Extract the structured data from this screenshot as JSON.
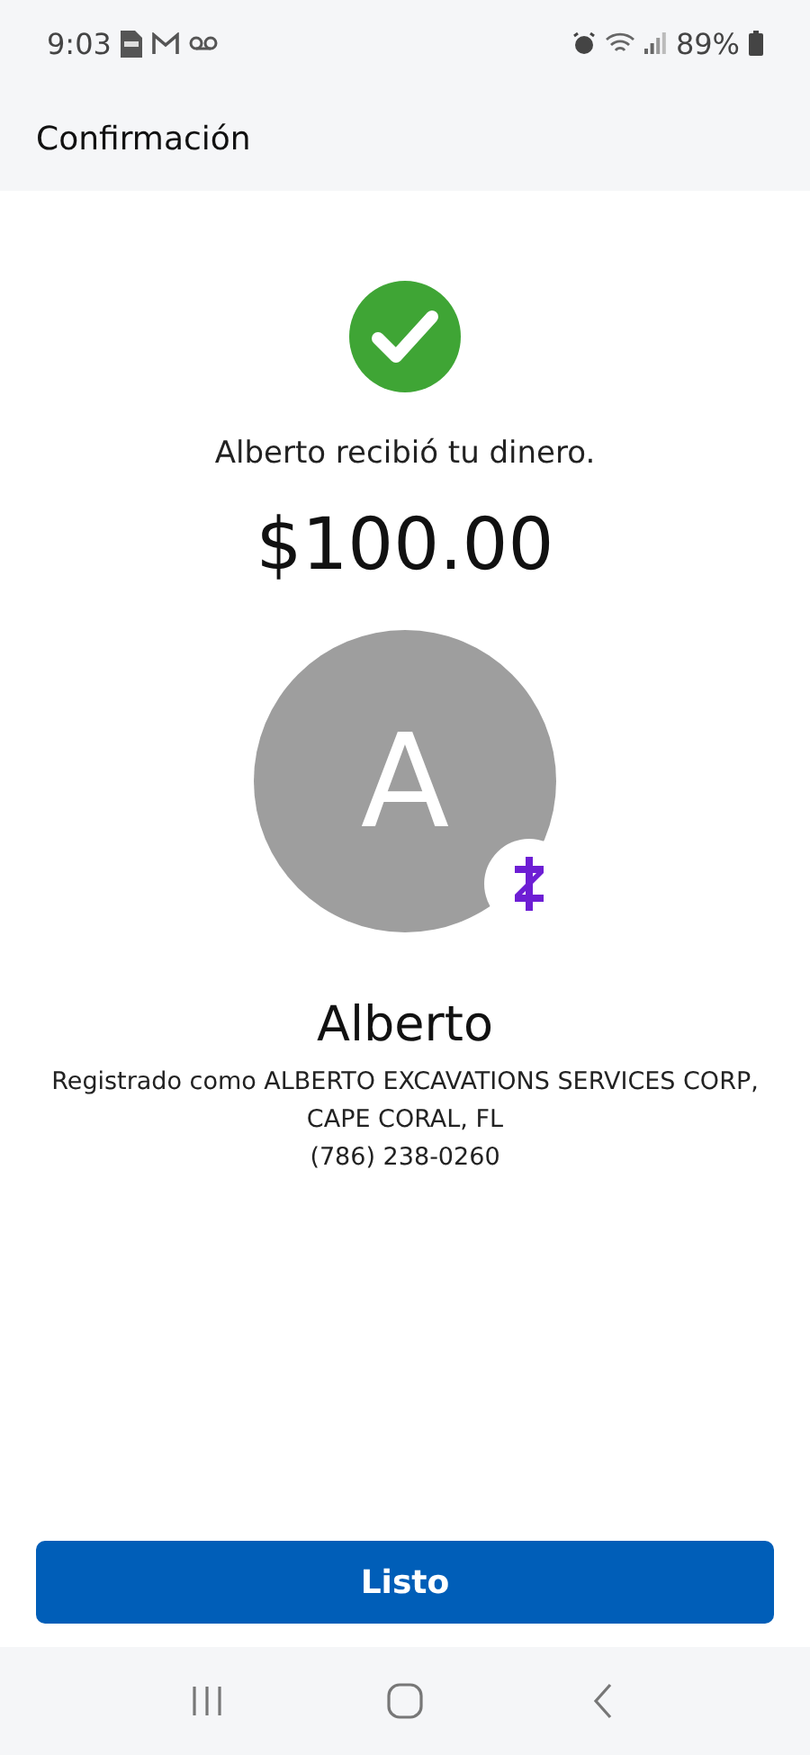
{
  "status_bar": {
    "time": "9:03",
    "battery": "89%"
  },
  "header": {
    "title": "Confirmación"
  },
  "confirmation": {
    "message": "Alberto recibió tu dinero.",
    "amount": "$100.00"
  },
  "recipient": {
    "initial": "A",
    "name": "Alberto",
    "details": [
      "Registrado como ALBERTO EXCAVATIONS SERVICES CORP,",
      "CAPE CORAL, FL",
      "(786) 238-0260"
    ]
  },
  "button": {
    "label": "Listo"
  }
}
